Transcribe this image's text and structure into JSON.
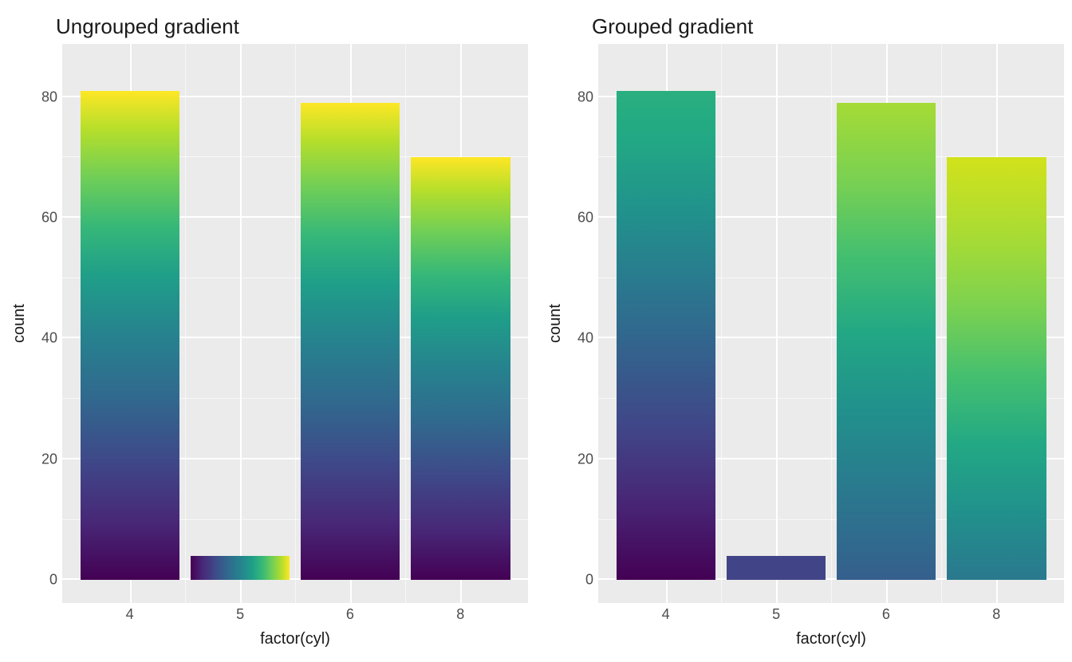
{
  "chart_data": [
    {
      "type": "bar",
      "title": "Ungrouped gradient",
      "xlabel": "factor(cyl)",
      "ylabel": "count",
      "categories": [
        "4",
        "5",
        "6",
        "8"
      ],
      "values": [
        81,
        4,
        79,
        70
      ],
      "ylim": [
        0,
        85
      ],
      "yticks": [
        0,
        20,
        40,
        60,
        80
      ],
      "gradient_mode": "per_bar_full",
      "gradient_colors": [
        "#440154",
        "#31688e",
        "#35b779",
        "#fde725"
      ]
    },
    {
      "type": "bar",
      "title": "Grouped gradient",
      "xlabel": "factor(cyl)",
      "ylabel": "count",
      "categories": [
        "4",
        "5",
        "6",
        "8"
      ],
      "values": [
        81,
        4,
        79,
        70
      ],
      "ylim": [
        0,
        85
      ],
      "yticks": [
        0,
        20,
        40,
        60,
        80
      ],
      "gradient_mode": "global_clipped",
      "gradient_colors": [
        "#440154",
        "#31688e",
        "#35b779",
        "#fde725"
      ]
    }
  ],
  "panels": {
    "left": {
      "title": "Ungrouped gradient",
      "ylabel": "count",
      "xlabel": "factor(cyl)"
    },
    "right": {
      "title": "Grouped gradient",
      "ylabel": "count",
      "xlabel": "factor(cyl)"
    }
  },
  "yticks": {
    "t0": "0",
    "t1": "20",
    "t2": "40",
    "t3": "60",
    "t4": "80"
  },
  "xticks": {
    "c0": "4",
    "c1": "5",
    "c2": "6",
    "c3": "8"
  }
}
